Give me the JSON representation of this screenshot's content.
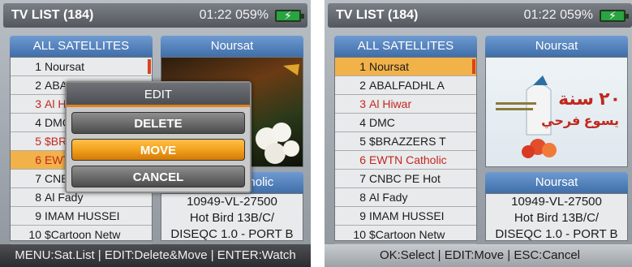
{
  "left_screen": {
    "title": "TV LIST (184)",
    "clock": "01:22 059%",
    "list_header": "ALL SATELLITES",
    "preview_header": "Noursat",
    "rows": [
      {
        "num": "1",
        "name": "Noursat"
      },
      {
        "num": "2",
        "name": "ABALFADHL A"
      },
      {
        "num": "3",
        "name": "Al Hiwar"
      },
      {
        "num": "4",
        "name": "DMC"
      },
      {
        "num": "5",
        "name": "$BRAZZERS T"
      },
      {
        "num": "6",
        "name": "EWTN Catholic"
      },
      {
        "num": "7",
        "name": "CNBC PE Hot"
      },
      {
        "num": "8",
        "name": "Al Fady"
      },
      {
        "num": "9",
        "name": "IMAM HUSSEI"
      },
      {
        "num": "10",
        "name": "$Cartoon Netw"
      }
    ],
    "info_header": "EWTN Catholic",
    "info_lines": [
      "10949-VL-27500",
      "Hot Bird 13B/C/",
      "DISEQC 1.0 - PORT B"
    ],
    "footer": "MENU:Sat.List | EDIT:Delete&Move | ENTER:Watch",
    "dialog": {
      "title": "EDIT",
      "delete": "DELETE",
      "move": "MOVE",
      "cancel": "CANCEL"
    }
  },
  "right_screen": {
    "title": "TV LIST (184)",
    "clock": "01:22 059%",
    "list_header": "ALL SATELLITES",
    "preview_header": "Noursat",
    "rows": [
      {
        "num": "1",
        "name": "Noursat"
      },
      {
        "num": "2",
        "name": "ABALFADHL A"
      },
      {
        "num": "3",
        "name": "Al Hiwar"
      },
      {
        "num": "4",
        "name": "DMC"
      },
      {
        "num": "5",
        "name": "$BRAZZERS T"
      },
      {
        "num": "6",
        "name": "EWTN Catholic"
      },
      {
        "num": "7",
        "name": "CNBC PE Hot"
      },
      {
        "num": "8",
        "name": "Al Fady"
      },
      {
        "num": "9",
        "name": "IMAM HUSSEI"
      },
      {
        "num": "10",
        "name": "$Cartoon Netw"
      }
    ],
    "info_header": "Noursat",
    "info_lines": [
      "10949-VL-27500",
      "Hot Bird 13B/C/",
      "DISEQC 1.0 - PORT B"
    ],
    "footer": "OK:Select | EDIT:Move | ESC:Cancel",
    "preview_text_main": "٢٠ سنة",
    "preview_text_sub": "يسوع فرحي"
  },
  "colors": {
    "selected_row": "#f2b24a",
    "red_channel": "#c1281e",
    "header_blue": "#3f6ea8",
    "move_highlight": "#f2a11c"
  },
  "icons": [
    "battery-icon",
    "scroll-marker"
  ]
}
